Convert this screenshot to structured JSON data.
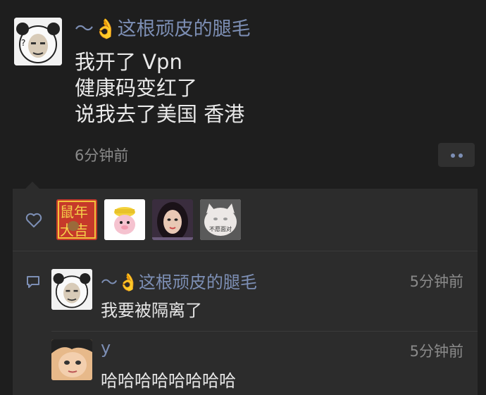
{
  "post": {
    "nickname": "～👌这根顽皮的腿毛",
    "lines": [
      "我开了 Vpn",
      "健康码变红了",
      "说我去了美国 香港"
    ],
    "time": "6分钟前"
  },
  "likes": {
    "icon": "heart-icon",
    "likers": [
      {
        "name": "鼠年大吉",
        "icon": "rat-year-sticker"
      },
      {
        "name": "",
        "icon": "cartoon-duck-avatar"
      },
      {
        "name": "",
        "icon": "girl-portrait-avatar"
      },
      {
        "name": "",
        "icon": "white-cat-avatar",
        "caption": "不愿面对"
      }
    ]
  },
  "comments": [
    {
      "name": "～👌这根顽皮的腿毛",
      "time": "5分钟前",
      "text": "我要被隔离了"
    },
    {
      "name": "y",
      "time": "5分钟前",
      "text": "哈哈哈哈哈哈哈哈"
    }
  ],
  "colors": {
    "nickname": "#7d8fb5",
    "background": "#1e1e1e",
    "panel": "#2c2c2c"
  }
}
